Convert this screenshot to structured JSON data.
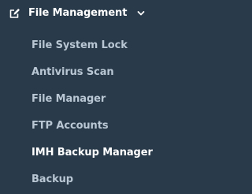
{
  "menu": {
    "title": "File Management",
    "icon": "edit-icon",
    "expanded": true,
    "colors": {
      "background": "#293a4a",
      "header_text": "#ffffff",
      "item_text": "#b9c6d3",
      "active_text": "#ffffff"
    },
    "items": [
      {
        "label": "File System Lock"
      },
      {
        "label": "Antivirus Scan"
      },
      {
        "label": "File Manager"
      },
      {
        "label": "FTP Accounts"
      },
      {
        "label": "IMH Backup Manager",
        "active": true
      },
      {
        "label": "Backup"
      }
    ]
  }
}
